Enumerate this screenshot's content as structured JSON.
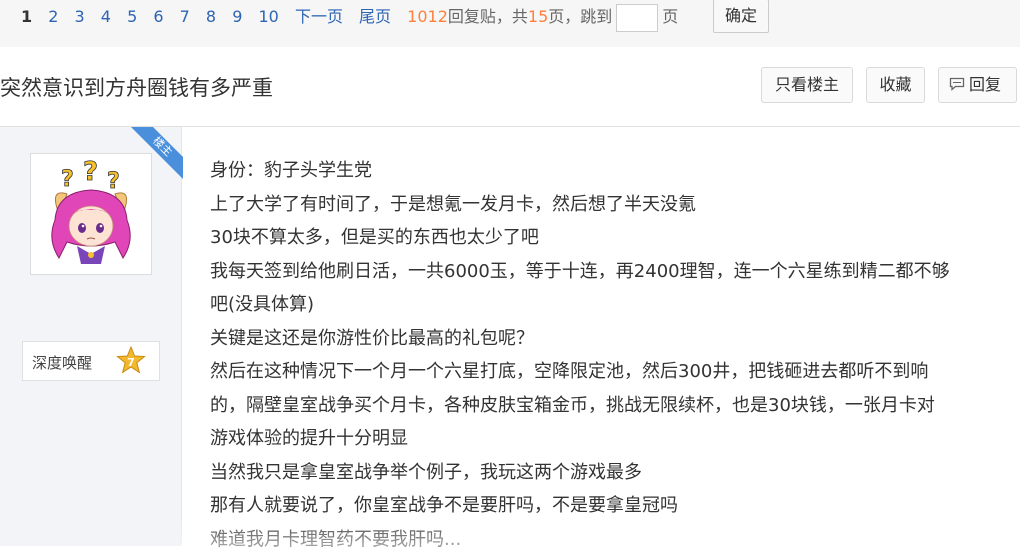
{
  "pager": {
    "current": "1",
    "pages": [
      "2",
      "3",
      "4",
      "5",
      "6",
      "7",
      "8",
      "9",
      "10"
    ],
    "next": "下一页",
    "last": "尾页",
    "reply_count": "1012",
    "reply_label": "回复贴，共",
    "page_total": "15",
    "page_suffix": "页",
    "jump_label": "跳到",
    "jump_suffix": "页",
    "confirm": "确定"
  },
  "thread": {
    "title": "突然意识到方舟圈钱有多严重",
    "only_op": "只看楼主",
    "favorite": "收藏",
    "reply": "回复"
  },
  "author": {
    "ribbon": "楼主",
    "name": "深度唤醒",
    "level": "7"
  },
  "post": {
    "lines": [
      "身份：豹子头学生党",
      "上了大学了有时间了，于是想氪一发月卡，然后想了半天没氪",
      "30块不算太多，但是买的东西也太少了吧",
      "我每天签到给他刷日活，一共6000玉，等于十连，再2400理智，连一个六星练到精二都不够",
      "吧(没具体算)",
      "关键是这还是你游性价比最高的礼包呢？",
      "然后在这种情况下一个月一个六星打底，空降限定池，然后300井，把钱砸进去都听不到响",
      "的，隔壁皇室战争买个月卡，各种皮肤宝箱金币，挑战无限续杯，也是30块钱，一张月卡对",
      "游戏体验的提升十分明显",
      "当然我只是拿皇室战争举个例子，我玩这两个游戏最多",
      "那有人就要说了，你皇室战争不是要肝吗，不是要拿皇冠吗",
      "难道我月卡理智药不要我肝吗..."
    ]
  },
  "colors": {
    "link": "#2d64b3",
    "count": "#ff7f3e",
    "ribbon": "#4a8fdc"
  }
}
